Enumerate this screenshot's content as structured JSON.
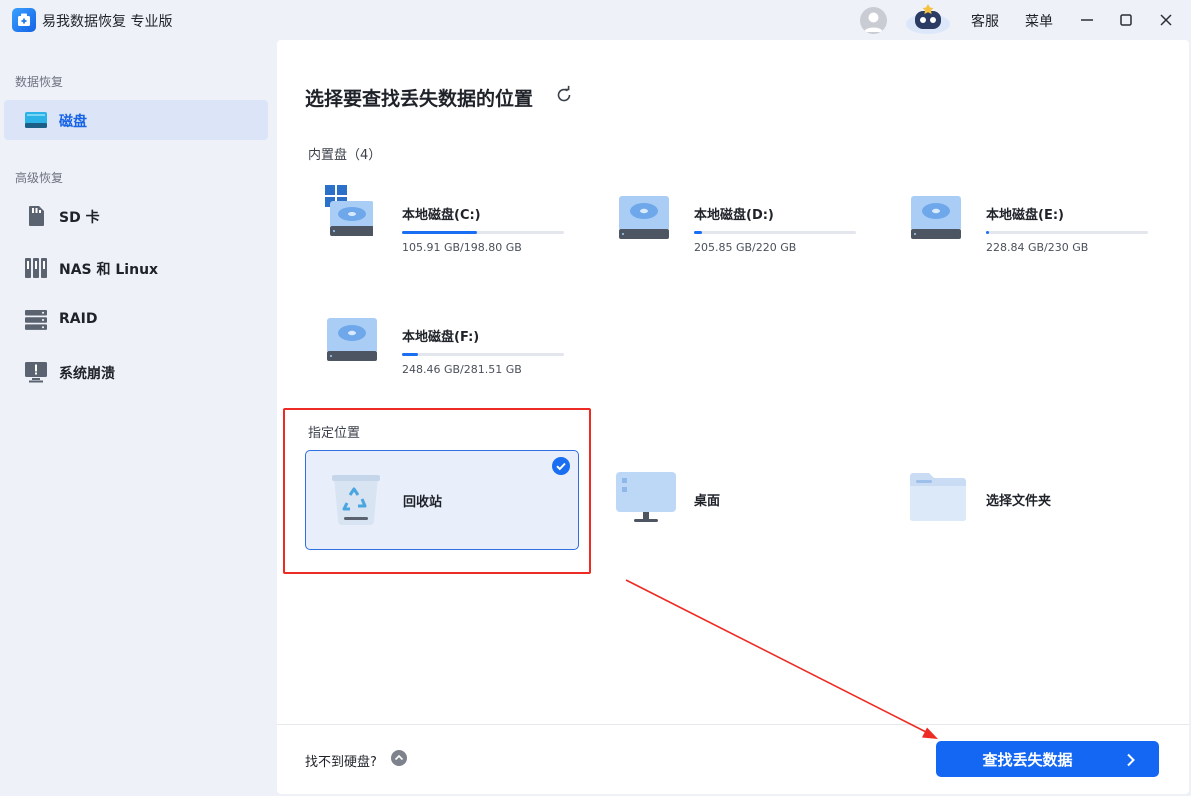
{
  "app": {
    "title": "易我数据恢复 专业版"
  },
  "titlebar": {
    "support_label": "客服",
    "menu_label": "菜单"
  },
  "sidebar": {
    "section_data_recovery": "数据恢复",
    "section_advanced": "高级恢复",
    "items": [
      {
        "label": "磁盘",
        "icon": "disk-icon",
        "active": true
      },
      {
        "label": "SD 卡",
        "icon": "sd-card-icon",
        "active": false
      },
      {
        "label": "NAS 和 Linux",
        "icon": "nas-icon",
        "active": false
      },
      {
        "label": "RAID",
        "icon": "raid-icon",
        "active": false
      },
      {
        "label": "系统崩溃",
        "icon": "system-crash-icon",
        "active": false
      }
    ]
  },
  "main": {
    "title": "选择要查找丢失数据的位置",
    "internal_label": "内置盘（4）",
    "drives": [
      {
        "name": "本地磁盘(C:)",
        "size": "105.91 GB/198.80 GB",
        "usage": 0.46,
        "system": true
      },
      {
        "name": "本地磁盘(D:)",
        "size": "205.85 GB/220 GB",
        "usage": 0.05,
        "system": false
      },
      {
        "name": "本地磁盘(E:)",
        "size": "228.84 GB/230 GB",
        "usage": 0.02,
        "system": false
      },
      {
        "name": "本地磁盘(F:)",
        "size": "248.46 GB/281.51 GB",
        "usage": 0.1,
        "system": false
      }
    ],
    "location_label": "指定位置",
    "locations": [
      {
        "name": "回收站",
        "icon": "recycle-bin-icon",
        "selected": true
      },
      {
        "name": "桌面",
        "icon": "desktop-icon",
        "selected": false
      },
      {
        "name": "选择文件夹",
        "icon": "folder-icon",
        "selected": false
      }
    ],
    "cant_find_label": "找不到硬盘?",
    "scan_button_label": "查找丢失数据"
  },
  "colors": {
    "accent": "#1467f2",
    "annotation": "#ee2a24"
  }
}
